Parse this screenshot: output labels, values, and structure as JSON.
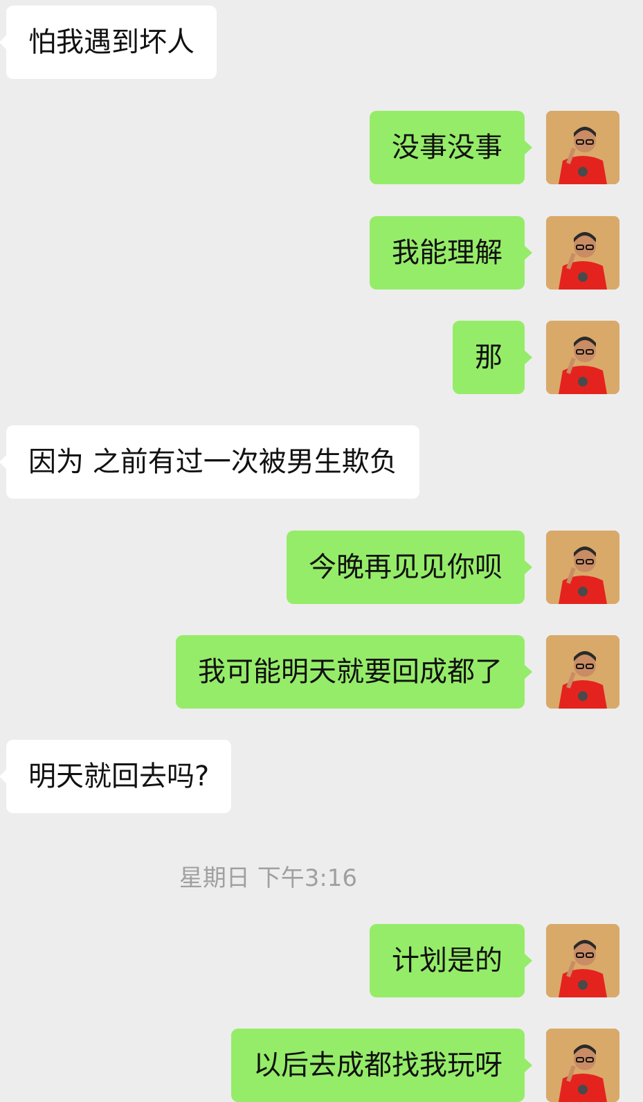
{
  "messages": [
    {
      "side": "left",
      "text": "怕我遇到坏人"
    },
    {
      "side": "right",
      "text": "没事没事"
    },
    {
      "side": "right",
      "text": "我能理解"
    },
    {
      "side": "right",
      "text": "那"
    },
    {
      "side": "left",
      "text": "因为 之前有过一次被男生欺负"
    },
    {
      "side": "right",
      "text": "今晚再见见你呗"
    },
    {
      "side": "right",
      "text": "我可能明天就要回成都了"
    },
    {
      "side": "left",
      "text": "明天就回去吗?"
    },
    {
      "side": "right",
      "text": "计划是的"
    },
    {
      "side": "right",
      "text": "以后去成都找我玩呀"
    }
  ],
  "timestamp": "星期日 下午3:16",
  "colors": {
    "background": "#ededed",
    "bubble_self": "#95ec69",
    "bubble_other": "#ffffff",
    "timestamp_text": "#a0a0a0"
  }
}
